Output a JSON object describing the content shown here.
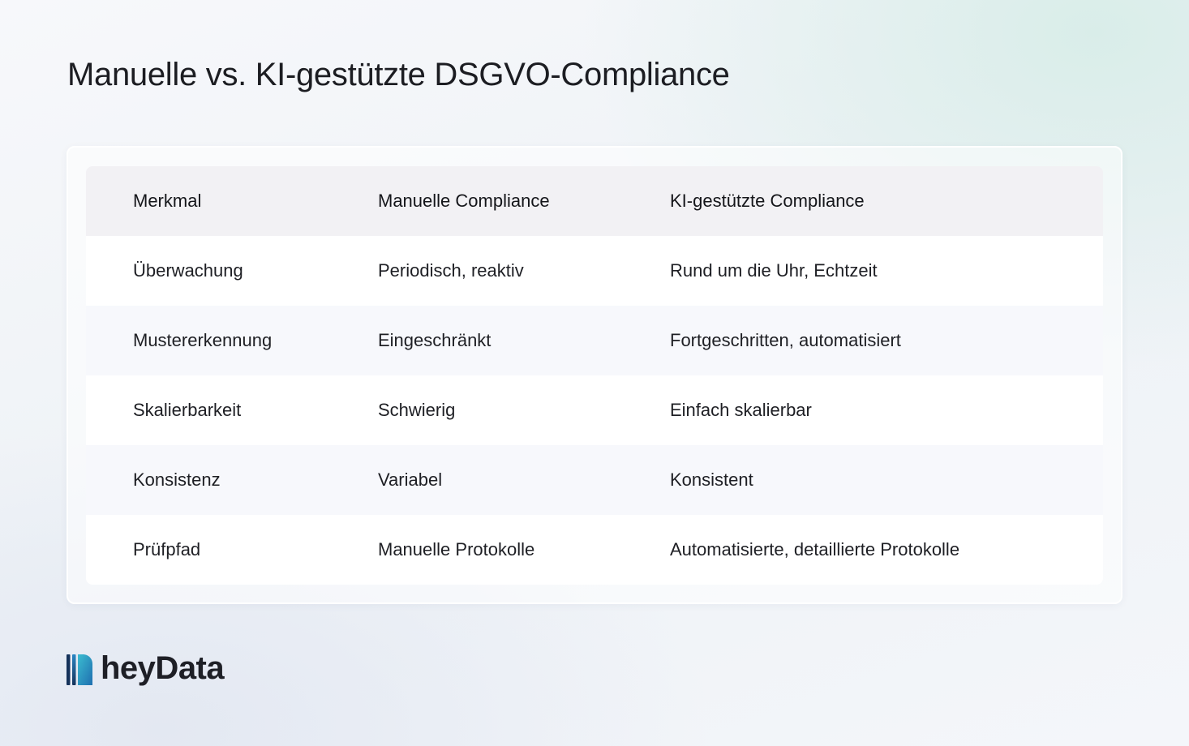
{
  "title": "Manuelle vs. KI-gestützte DSGVO-Compliance",
  "table": {
    "headers": [
      "Merkmal",
      "Manuelle Compliance",
      "KI-gestützte Compliance"
    ],
    "rows": [
      [
        "Überwachung",
        "Periodisch, reaktiv",
        "Rund um die Uhr, Echtzeit"
      ],
      [
        "Mustererkennung",
        "Eingeschränkt",
        "Fortgeschritten, automatisiert"
      ],
      [
        "Skalierbarkeit",
        "Schwierig",
        "Einfach skalierbar"
      ],
      [
        "Konsistenz",
        "Variabel",
        "Konsistent"
      ],
      [
        "Prüfpfad",
        "Manuelle Protokolle",
        "Automatisierte, detaillierte Protokolle"
      ]
    ]
  },
  "brand": {
    "name": "heyData",
    "icon": "heydata-logo-icon",
    "colors": {
      "logo_dark": "#15325a",
      "logo_mid": "#1f6fb0",
      "logo_light": "#33b3c9"
    }
  }
}
